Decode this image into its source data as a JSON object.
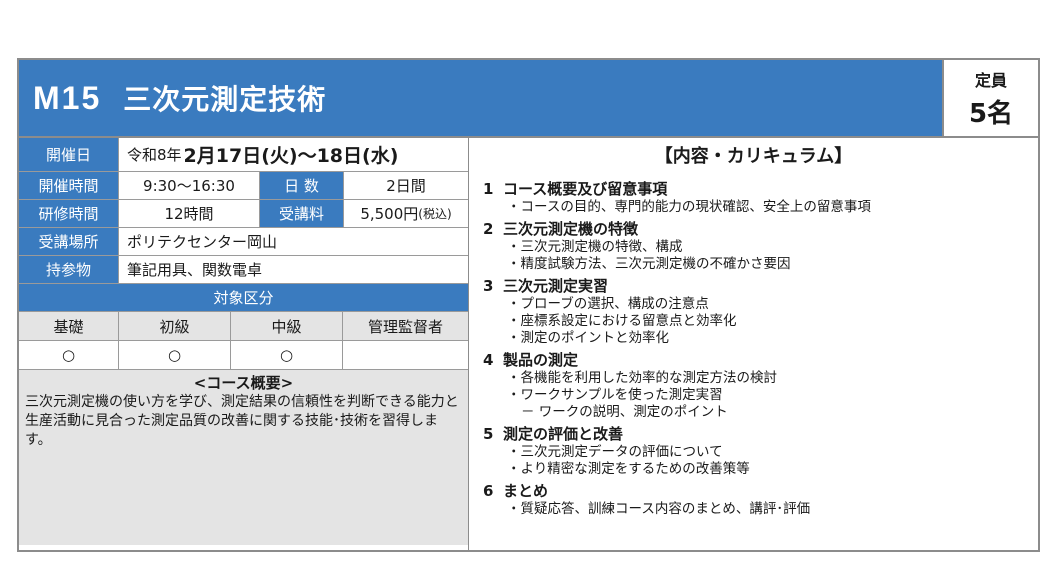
{
  "header": {
    "code": "M15",
    "title": "三次元測定技術",
    "capacity_label": "定員",
    "capacity_value": "5名"
  },
  "info": {
    "date_label": "開催日",
    "date_prefix": "令和8年",
    "date_value": "2月17日(火)～18日(水)",
    "time_label": "開催時間",
    "time_value": "9:30～16:30",
    "days_label": "日 数",
    "days_value": "2日間",
    "hours_label": "研修時間",
    "hours_value": "12時間",
    "fee_label": "受講料",
    "fee_value": "5,500円",
    "fee_note": "(税込)",
    "venue_label": "受講場所",
    "venue_value": "ポリテクセンター岡山",
    "items_label": "持参物",
    "items_value": "筆記用具、関数電卓"
  },
  "target": {
    "heading": "対象区分",
    "levels": [
      "基礎",
      "初級",
      "中級",
      "管理監督者"
    ],
    "marks": [
      "○",
      "○",
      "○",
      ""
    ]
  },
  "overview": {
    "title": "<コース概要>",
    "text": "三次元測定機の使い方を学び、測定結果の信頼性を判断できる能力と生産活動に見合った測定品質の改善に関する技能･技術を習得します。"
  },
  "curriculum": {
    "title": "【内容・カリキュラム】",
    "sections": [
      {
        "num": "1",
        "heading": "コース概要及び留意事項",
        "items": [
          "・コースの目的、専門的能力の現状確認、安全上の留意事項"
        ]
      },
      {
        "num": "2",
        "heading": "三次元測定機の特徴",
        "items": [
          "・三次元測定機の特徴、構成",
          "・精度試験方法、三次元測定機の不確かさ要因"
        ]
      },
      {
        "num": "3",
        "heading": "三次元測定実習",
        "items": [
          "・プローブの選択、構成の注意点",
          "・座標系設定における留意点と効率化",
          "・測定のポイントと効率化"
        ]
      },
      {
        "num": "4",
        "heading": "製品の測定",
        "items": [
          "・各機能を利用した効率的な測定方法の検討",
          "・ワークサンプルを使った測定実習"
        ],
        "sub": "－ ワークの説明、測定のポイント"
      },
      {
        "num": "5",
        "heading": "測定の評価と改善",
        "items": [
          "・三次元測定データの評価について",
          "・より精密な測定をするための改善策等"
        ]
      },
      {
        "num": "6",
        "heading": "まとめ",
        "items": [
          "・質疑応答、訓練コース内容のまとめ、講評･評価"
        ]
      }
    ]
  },
  "colors": {
    "accent": "#3a7bbf",
    "panel": "#e4e4e4",
    "border": "#8c8c8c"
  }
}
